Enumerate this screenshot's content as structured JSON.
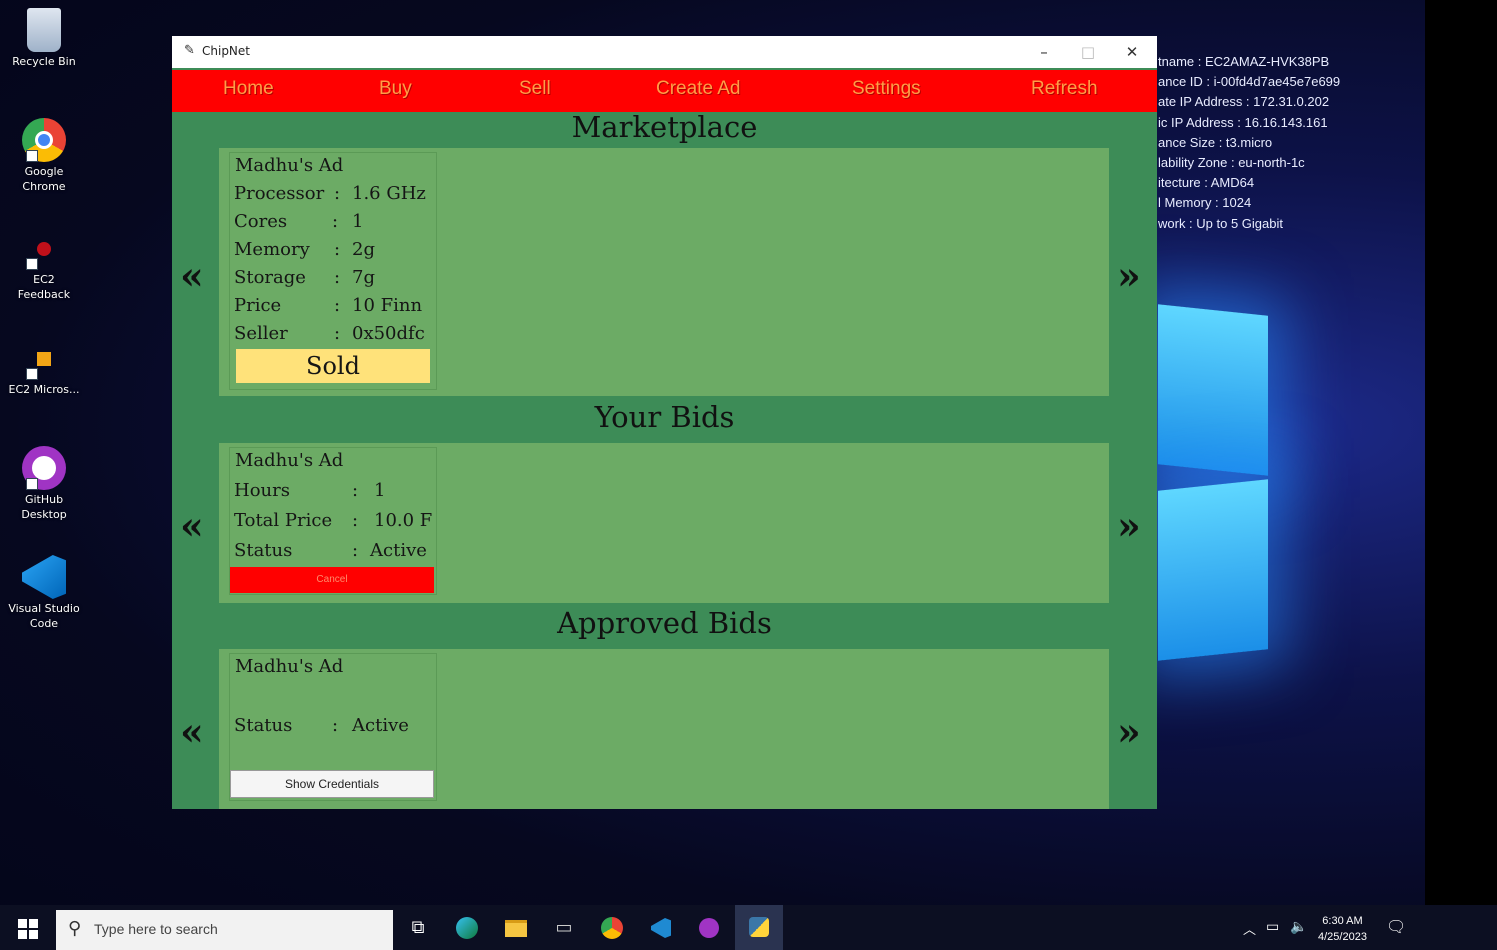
{
  "desktop": {
    "icons": [
      {
        "label": "Recycle Bin"
      },
      {
        "label": "Google Chrome"
      },
      {
        "label": "EC2 Feedback"
      },
      {
        "label": "EC2 Micros..."
      },
      {
        "label": "GitHub Desktop"
      },
      {
        "label": "Visual Studio Code"
      }
    ],
    "sysinfo": [
      "tname : EC2AMAZ-HVK38PB",
      "ance ID : i-00fd4d7ae45e7e699",
      "ate IP Address : 172.31.0.202",
      "ic IP Address : 16.16.143.161",
      "ance Size : t3.micro",
      "lability Zone : eu-north-1c",
      "itecture : AMD64",
      "l Memory : 1024",
      "work : Up to 5 Gigabit"
    ]
  },
  "window": {
    "title": "ChipNet",
    "controls": {
      "minimize": "–",
      "maximize": "□",
      "close": "✕"
    }
  },
  "menu": [
    "Home",
    "Buy",
    "Sell",
    "Create Ad",
    "Settings",
    "Refresh"
  ],
  "marketplace": {
    "heading": "Marketplace",
    "prev": "«",
    "next": "»",
    "card": {
      "title": "Madhu's Ad",
      "rows": [
        {
          "key": "Processor",
          "sep": ":",
          "value": "1.6 GHz"
        },
        {
          "key": "Cores",
          "sep": ":",
          "value": "1"
        },
        {
          "key": "Memory",
          "sep": ":",
          "value": "2g"
        },
        {
          "key": "Storage",
          "sep": ":",
          "value": "7g"
        },
        {
          "key": "Price",
          "sep": ":",
          "value": "10 Finn"
        },
        {
          "key": "Seller",
          "sep": ":",
          "value": "0x50dfc"
        }
      ],
      "button": "Sold"
    }
  },
  "your_bids": {
    "heading": "Your Bids",
    "prev": "«",
    "next": "»",
    "card": {
      "title": "Madhu's Ad",
      "rows": [
        {
          "key": "Hours",
          "sep": ":",
          "value": "1"
        },
        {
          "key": "Total Price",
          "sep": ":",
          "value": "10.0 F"
        },
        {
          "key": "Status",
          "sep": ":",
          "value": "Active"
        }
      ],
      "button": "Cancel"
    }
  },
  "approved_bids": {
    "heading": "Approved Bids",
    "prev": "«",
    "next": "»",
    "card": {
      "title": "Madhu's Ad",
      "rows": [
        {
          "key": "Status",
          "sep": ":",
          "value": "Active"
        }
      ],
      "button": "Show Credentials"
    }
  },
  "taskbar": {
    "search_placeholder": "Type here to search",
    "time": "6:30 AM",
    "date": "4/25/2023"
  }
}
